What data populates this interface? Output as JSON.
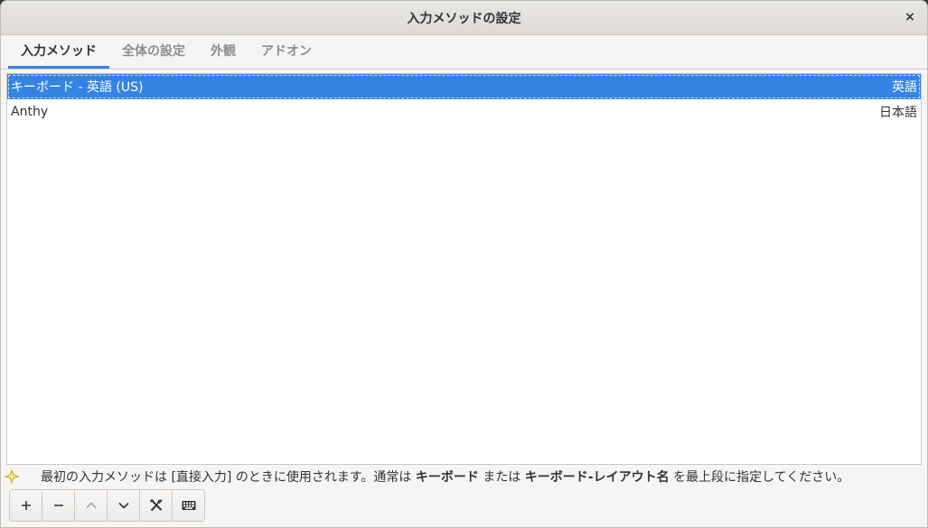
{
  "window": {
    "title": "入力メソッドの設定",
    "close_label": "×"
  },
  "tabs": [
    {
      "label": "入力メソッド",
      "active": true
    },
    {
      "label": "全体の設定",
      "active": false
    },
    {
      "label": "外観",
      "active": false
    },
    {
      "label": "アドオン",
      "active": false
    }
  ],
  "input_methods": [
    {
      "name": "キーボード - 英語 (US)",
      "language": "英語",
      "selected": true
    },
    {
      "name": "Anthy",
      "language": "日本語",
      "selected": false
    }
  ],
  "hint": {
    "icon": "info-star-icon",
    "part1": "最初の入力メソッドは [直接入力] のときに使用されます。通常は ",
    "bold1": "キーボード",
    "part2": " または ",
    "bold2": "キーボード-レイアウト名",
    "part3": " を最上段に指定してください。"
  },
  "toolbar": {
    "buttons": [
      {
        "icon": "add-icon",
        "enabled": true
      },
      {
        "icon": "remove-icon",
        "enabled": true
      },
      {
        "icon": "move-up-icon",
        "enabled": false
      },
      {
        "icon": "move-down-icon",
        "enabled": true
      },
      {
        "icon": "configure-icon",
        "enabled": true
      },
      {
        "icon": "keyboard-layout-icon",
        "enabled": true
      }
    ]
  },
  "colors": {
    "accent": "#3584e4",
    "hint_star": "#f5c211"
  }
}
